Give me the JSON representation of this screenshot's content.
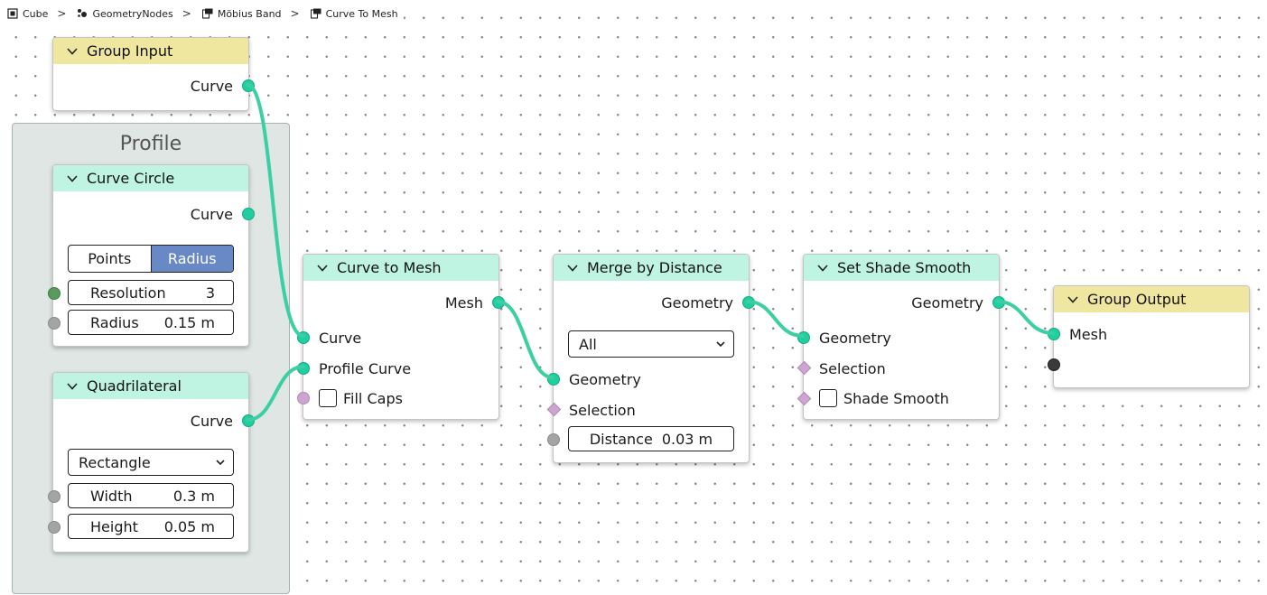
{
  "breadcrumb": [
    {
      "label": "Cube",
      "icon": "object-icon"
    },
    {
      "label": "GeometryNodes",
      "icon": "geometry-nodes-modifier-icon"
    },
    {
      "label": "Möbius Band",
      "icon": "node-tree-icon"
    },
    {
      "label": "Curve To Mesh",
      "icon": "node-tree-icon"
    }
  ],
  "colors": {
    "link": "#3ccfa3",
    "geometry_socket": "#1fcf9f",
    "header_group": "#efe6a0",
    "header_geometry": "#bff3e2",
    "active_toggle": "#6889c5"
  },
  "frame": {
    "label": "Profile"
  },
  "nodes": {
    "group_input": {
      "title": "Group Input",
      "outputs": [
        "Curve"
      ]
    },
    "curve_circle": {
      "title": "Curve Circle",
      "outputs": [
        "Curve"
      ],
      "mode": [
        "Points",
        "Radius"
      ],
      "mode_active": "Radius",
      "resolution": {
        "label": "Resolution",
        "value": "3"
      },
      "radius": {
        "label": "Radius",
        "value": "0.15 m"
      }
    },
    "quadrilateral": {
      "title": "Quadrilateral",
      "outputs": [
        "Curve"
      ],
      "mode": "Rectangle",
      "width": {
        "label": "Width",
        "value": "0.3 m"
      },
      "height": {
        "label": "Height",
        "value": "0.05 m"
      }
    },
    "curve_to_mesh": {
      "title": "Curve to Mesh",
      "outputs": [
        "Mesh"
      ],
      "inputs": [
        "Curve",
        "Profile Curve",
        "Fill Caps"
      ]
    },
    "merge_by_distance": {
      "title": "Merge by Distance",
      "outputs": [
        "Geometry"
      ],
      "mode": "All",
      "inputs": [
        "Geometry",
        "Selection"
      ],
      "distance": {
        "label": "Distance",
        "value": "0.03 m"
      }
    },
    "set_shade_smooth": {
      "title": "Set Shade Smooth",
      "outputs": [
        "Geometry"
      ],
      "inputs": [
        "Geometry",
        "Selection",
        "Shade Smooth"
      ]
    },
    "group_output": {
      "title": "Group Output",
      "inputs": [
        "Mesh"
      ]
    }
  }
}
